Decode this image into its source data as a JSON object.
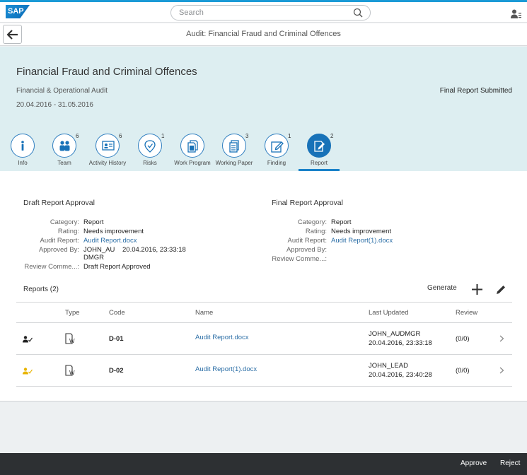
{
  "shell": {
    "logo_text": "SAP",
    "search_placeholder": "Search"
  },
  "titlebar": {
    "title": "Audit: Financial Fraud and Criminal Offences"
  },
  "header": {
    "title": "Financial Fraud and Criminal Offences",
    "subtitle": "Financial & Operational Audit",
    "dates": "20.04.2016 - 31.05.2016",
    "status": "Final Report Submitted"
  },
  "tabs": [
    {
      "label": "Info",
      "count": "",
      "icon": "info-icon"
    },
    {
      "label": "Team",
      "count": "6",
      "icon": "team-icon"
    },
    {
      "label": "Activity History",
      "count": "6",
      "icon": "activity-history-icon"
    },
    {
      "label": "Risks",
      "count": "1",
      "icon": "risks-icon"
    },
    {
      "label": "Work Program",
      "count": "",
      "icon": "work-program-icon"
    },
    {
      "label": "Working Paper",
      "count": "3",
      "icon": "working-paper-icon"
    },
    {
      "label": "Finding",
      "count": "1",
      "icon": "finding-icon"
    },
    {
      "label": "Report",
      "count": "2",
      "icon": "report-icon",
      "active": true
    }
  ],
  "draft": {
    "title": "Draft Report Approval",
    "fields": [
      {
        "label": "Category:",
        "value": "Report"
      },
      {
        "label": "Rating:",
        "value": "Needs improvement"
      },
      {
        "label": "Audit Report:",
        "value": "Audit Report.docx"
      },
      {
        "label": "Approved By:",
        "value_line1": "JOHN_AU",
        "value_line2": "DMGR",
        "value_date": "20.04.2016, 23:33:18"
      },
      {
        "label": "Review Comme...:",
        "value": "Draft Report Approved"
      }
    ]
  },
  "final": {
    "title": "Final Report Approval",
    "fields": [
      {
        "label": "Category:",
        "value": "Report"
      },
      {
        "label": "Rating:",
        "value": "Needs improvement"
      },
      {
        "label": "Audit Report:",
        "value": "Audit Report(1).docx"
      },
      {
        "label": "Approved By:",
        "value": ""
      },
      {
        "label": "Review Comme...:",
        "value": ""
      }
    ]
  },
  "reports": {
    "title": "Reports (2)",
    "generate_label": "Generate",
    "columns": [
      "Type",
      "Code",
      "Name",
      "Last Updated",
      "Review"
    ],
    "rows": [
      {
        "status_color": "#222222",
        "code": "D-01",
        "name": "Audit Report.docx",
        "updated_by": "JOHN_AUDMGR",
        "updated_at": "20.04.2016, 23:33:18",
        "review": "(0/0)"
      },
      {
        "status_color": "#e8b400",
        "code": "D-02",
        "name": "Audit Report(1).docx",
        "updated_by": "JOHN_LEAD",
        "updated_at": "20.04.2016, 23:40:28",
        "review": "(0/0)"
      }
    ]
  },
  "footer": {
    "approve_label": "Approve",
    "reject_label": "Reject"
  },
  "colors": {
    "accent": "#1872b8",
    "header_bg": "#ddeef1",
    "footer_bg": "#2d3033",
    "link": "#2b6ea6"
  }
}
